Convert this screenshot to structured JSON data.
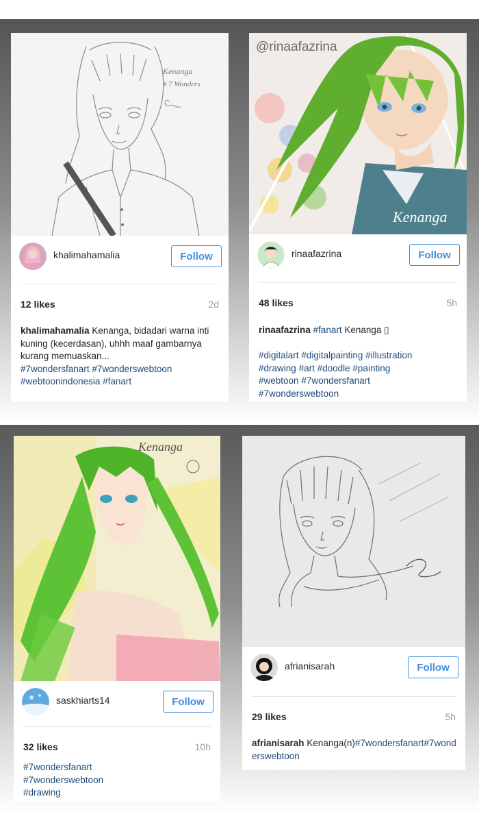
{
  "colors": {
    "follow_blue": "#3f8fdb",
    "hashtag": "#1f4a7a",
    "muted": "#9a9a9a"
  },
  "posts": [
    {
      "username": "khalimahamalia",
      "follow_label": "Follow",
      "likes": "12 likes",
      "time": "2d",
      "caption_user": "khalimahamalia",
      "caption_text": " Kenanga, bidadari warna inti kuning (kecerdasan), uhhh maaf gambarnya kurang memuaskan... ",
      "tags": [
        "#7wondersfanart",
        "#7wonderswebtoon",
        "#webtoonindonesia",
        "#fanart"
      ],
      "art_text": [
        "Kenanga",
        "# 7 Wonders"
      ]
    },
    {
      "username": "rinaafazrina",
      "follow_label": "Follow",
      "likes": "48 likes",
      "time": "5h",
      "caption_user": "rinaafazrina",
      "caption_tag": "#fanart",
      "caption_text": " Kenanga ",
      "caption_emoji": "▯",
      "tags": [
        "#digitalart",
        "#digitalpainting",
        "#illustration",
        "#drawing",
        "#art",
        "#doodle",
        "#painting",
        "#webtoon",
        "#7wondersfanart",
        "#7wonderswebtoon"
      ],
      "art_watermark": "@rinaafazrina",
      "art_signature": "Kenanga"
    },
    {
      "username": "saskhiarts14",
      "follow_label": "Follow",
      "likes": "32 likes",
      "time": "10h",
      "tags": [
        "#7wondersfanart",
        "#7wonderswebtoon",
        "#drawing"
      ],
      "art_text": "Kenanga"
    },
    {
      "username": "afrianisarah",
      "follow_label": "Follow",
      "likes": "29 likes",
      "time": "5h",
      "caption_user": "afrianisarah",
      "caption_text": " Kenanga(n)",
      "caption_tag_line": "#7wondersfanart#7wonderswebtoon"
    }
  ]
}
